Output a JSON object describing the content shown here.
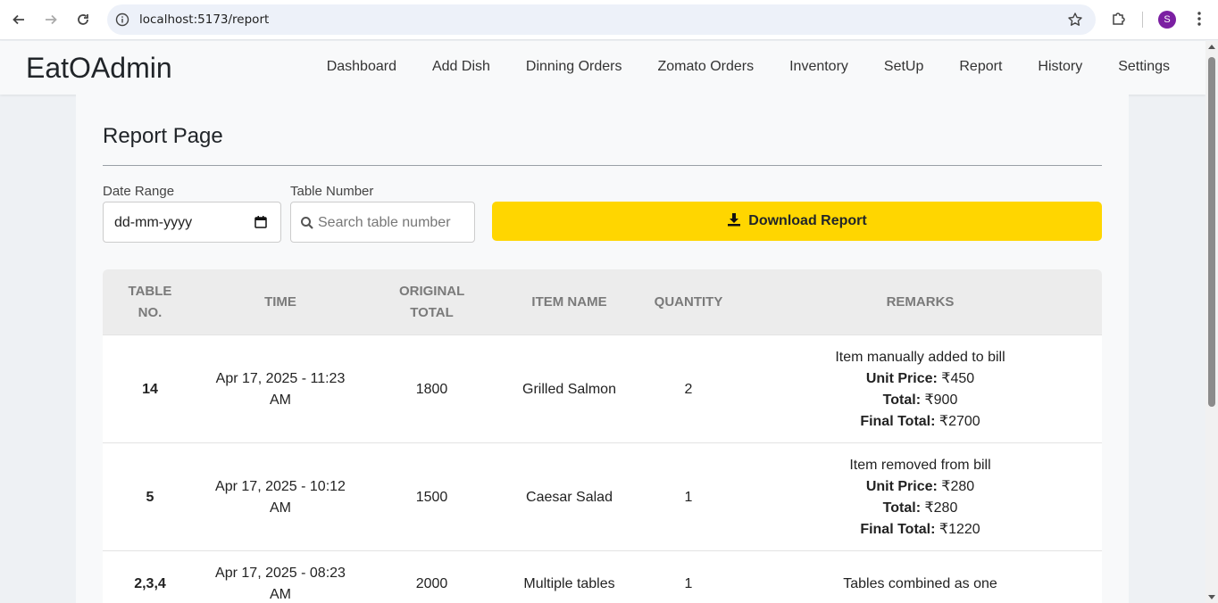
{
  "browser": {
    "url": "localhost:5173/report",
    "profile_initial": "S"
  },
  "app": {
    "brand": "EatOAdmin",
    "nav": [
      "Dashboard",
      "Add Dish",
      "Dinning Orders",
      "Zomato Orders",
      "Inventory",
      "SetUp",
      "Report",
      "History",
      "Settings"
    ]
  },
  "page": {
    "title": "Report Page",
    "date_label": "Date Range",
    "date_placeholder": "dd-mm-yyyy",
    "table_label": "Table Number",
    "table_placeholder": "Search table number",
    "download_label": "Download Report"
  },
  "table": {
    "headers": [
      "TABLE NO.",
      "TIME",
      "ORIGINAL TOTAL",
      "ITEM NAME",
      "QUANTITY",
      "REMARKS"
    ],
    "rows": [
      {
        "table_no": "14",
        "time": "Apr 17, 2025 - 11:23 AM",
        "original_total": "1800",
        "item_name": "Grilled Salmon",
        "quantity": "2",
        "remark": "Item manually added to bill",
        "unit_price_label": "Unit Price:",
        "unit_price": " ₹450",
        "total_label": "Total:",
        "total": " ₹900",
        "final_total_label": "Final Total:",
        "final_total": " ₹2700"
      },
      {
        "table_no": "5",
        "time": "Apr 17, 2025 - 10:12 AM",
        "original_total": "1500",
        "item_name": "Caesar Salad",
        "quantity": "1",
        "remark": "Item removed from bill",
        "unit_price_label": "Unit Price:",
        "unit_price": " ₹280",
        "total_label": "Total:",
        "total": " ₹280",
        "final_total_label": "Final Total:",
        "final_total": " ₹1220"
      },
      {
        "table_no": "2,3,4",
        "time": "Apr 17, 2025 - 08:23 AM",
        "original_total": "2000",
        "item_name": "Multiple tables",
        "quantity": "1",
        "remark": "Tables combined as one"
      }
    ]
  },
  "colors": {
    "accent": "#ffd600",
    "avatar": "#7b1fa2"
  }
}
